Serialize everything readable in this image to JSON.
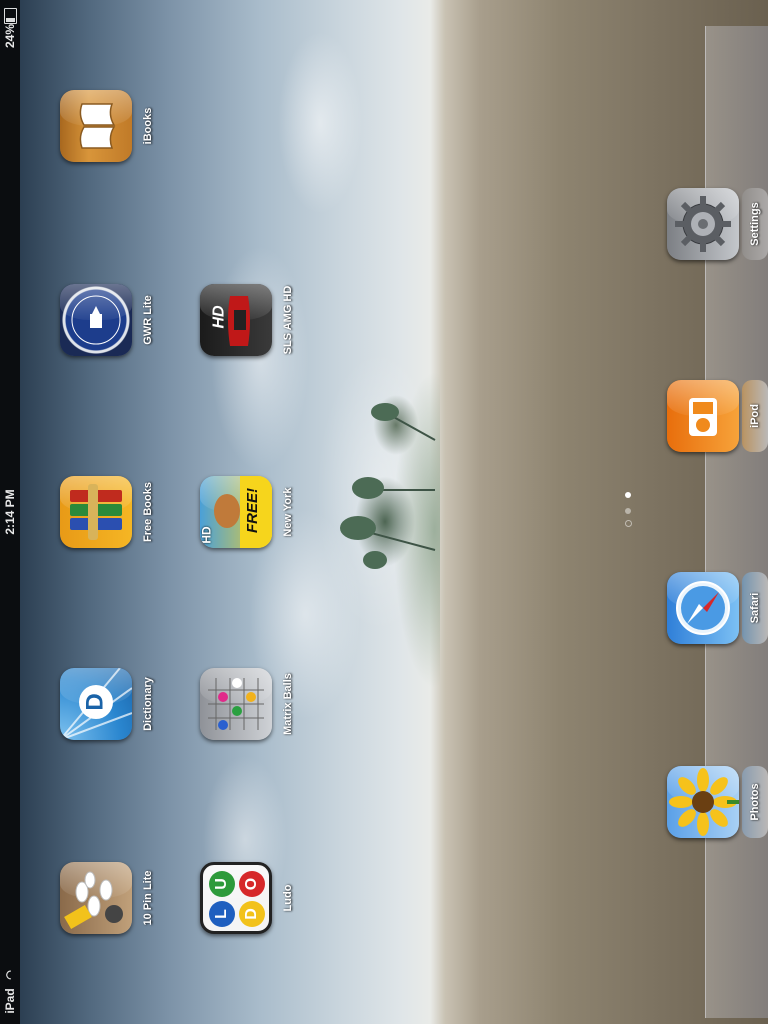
{
  "status_bar": {
    "carrier": "iPad",
    "time": "2:14 PM",
    "battery": "24%"
  },
  "apps": [
    {
      "label": "iBooks",
      "icon": "ibooks-icon"
    },
    {
      "label": "GWR Lite",
      "icon": "guinness-world-records-icon"
    },
    {
      "label": "SLS AMG HD",
      "icon": "sls-amg-car-icon"
    },
    {
      "label": "Free Books",
      "icon": "free-books-icon"
    },
    {
      "label": "New York",
      "icon": "new-york-free-icon"
    },
    {
      "label": "Dictionary",
      "icon": "dictionary-icon"
    },
    {
      "label": "Matrix Balls",
      "icon": "matrix-balls-icon"
    },
    {
      "label": "10 Pin Lite",
      "icon": "bowling-pins-icon"
    },
    {
      "label": "Ludo",
      "icon": "ludo-icon"
    }
  ],
  "dock": [
    {
      "label": "Settings",
      "icon": "settings-gear-icon"
    },
    {
      "label": "iPod",
      "icon": "ipod-icon"
    },
    {
      "label": "Safari",
      "icon": "safari-compass-icon"
    },
    {
      "label": "Photos",
      "icon": "photos-sunflower-icon"
    }
  ],
  "icon_text": {
    "new_york_badge": "FREE!",
    "new_york_hd": "HD",
    "sls_hd": "HD",
    "ludo_letters": [
      "L",
      "U",
      "D",
      "O"
    ],
    "dictionary_letter": "D"
  },
  "colors": {
    "ludo_red": "#d6282a",
    "ludo_yellow": "#f2c21b",
    "ludo_green": "#2d9a3a",
    "ludo_blue": "#1f5fbf",
    "ipod_orange": "#f08a1c",
    "safari_blue": "#2f7fd8"
  },
  "page_indicator": {
    "pages": 2,
    "current": 1
  }
}
